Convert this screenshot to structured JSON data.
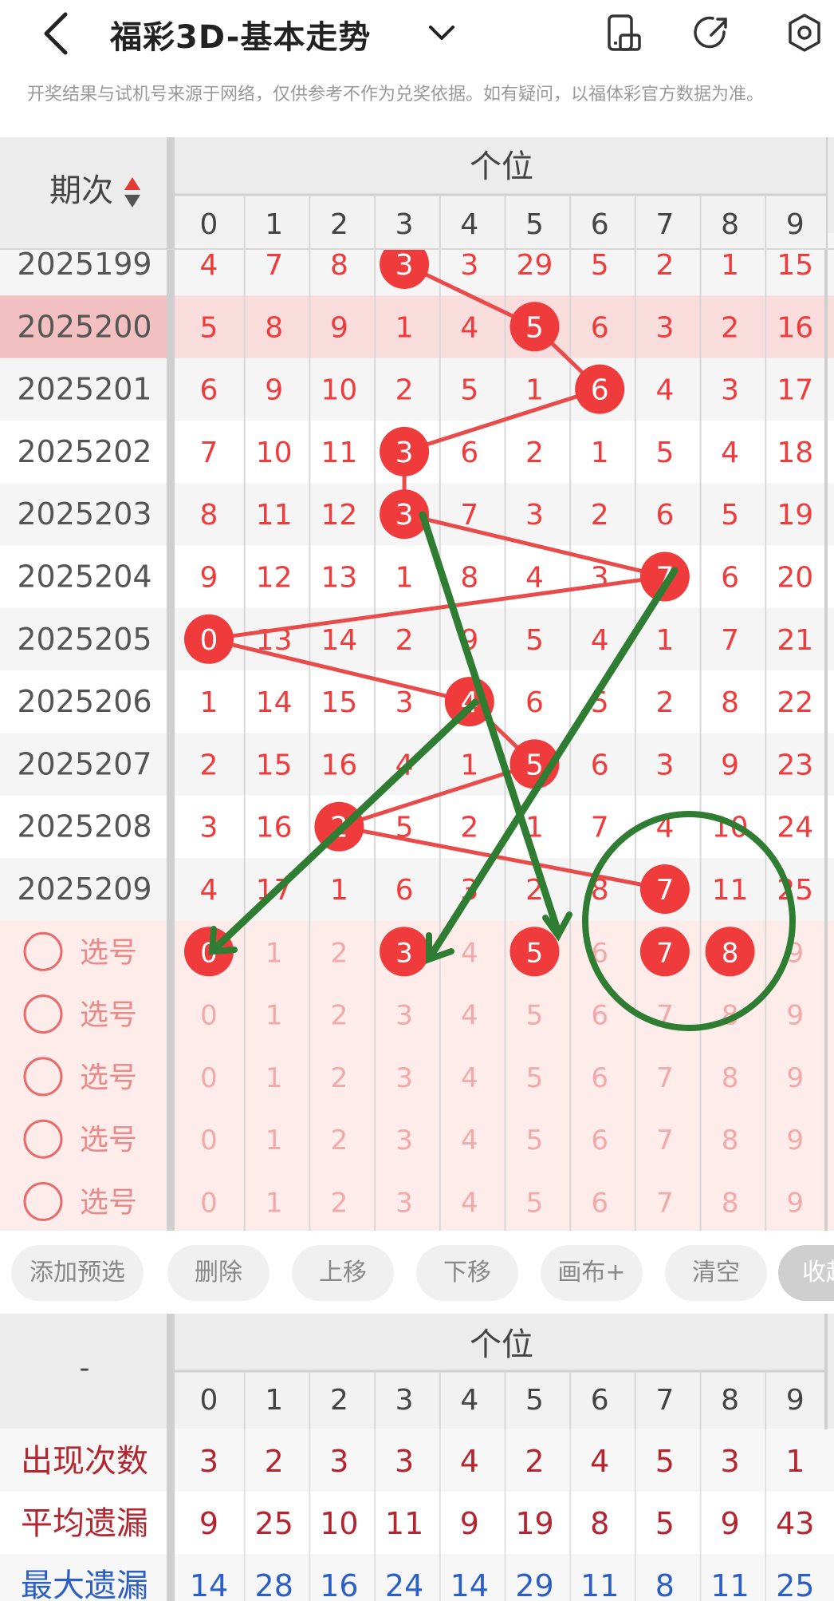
{
  "header": {
    "title": "福彩3D-基本走势",
    "icons": [
      "back-icon",
      "chevron-down-icon",
      "phone-rotate-icon",
      "share-icon",
      "settings-icon"
    ]
  },
  "notice": "开奖结果与试机号来源于网络，仅供参考不作为兑奖依据。如有疑问，以福体彩官方数据为准。",
  "table": {
    "period_header": "期次",
    "group_header": "个位",
    "digits": [
      "0",
      "1",
      "2",
      "3",
      "4",
      "5",
      "6",
      "7",
      "8",
      "9"
    ],
    "rows": [
      {
        "period": "2025199",
        "values": [
          "4",
          "7",
          "8",
          "3",
          "3",
          "29",
          "5",
          "2",
          "1",
          "15"
        ],
        "hit": 3
      },
      {
        "period": "2025200",
        "values": [
          "5",
          "8",
          "9",
          "1",
          "4",
          "5",
          "6",
          "3",
          "2",
          "16"
        ],
        "hit": 5,
        "highlight": true
      },
      {
        "period": "2025201",
        "values": [
          "6",
          "9",
          "10",
          "2",
          "5",
          "1",
          "6",
          "4",
          "3",
          "17"
        ],
        "hit": 6
      },
      {
        "period": "2025202",
        "values": [
          "7",
          "10",
          "11",
          "3",
          "6",
          "2",
          "1",
          "5",
          "4",
          "18"
        ],
        "hit": 3
      },
      {
        "period": "2025203",
        "values": [
          "8",
          "11",
          "12",
          "3",
          "7",
          "3",
          "2",
          "6",
          "5",
          "19"
        ],
        "hit": 3
      },
      {
        "period": "2025204",
        "values": [
          "9",
          "12",
          "13",
          "1",
          "8",
          "4",
          "3",
          "7",
          "6",
          "20"
        ],
        "hit": 7
      },
      {
        "period": "2025205",
        "values": [
          "0",
          "13",
          "14",
          "2",
          "9",
          "5",
          "4",
          "1",
          "7",
          "21"
        ],
        "hit": 0
      },
      {
        "period": "2025206",
        "values": [
          "1",
          "14",
          "15",
          "3",
          "4",
          "6",
          "5",
          "2",
          "8",
          "22"
        ],
        "hit": 4
      },
      {
        "period": "2025207",
        "values": [
          "2",
          "15",
          "16",
          "4",
          "1",
          "5",
          "6",
          "3",
          "9",
          "23"
        ],
        "hit": 5
      },
      {
        "period": "2025208",
        "values": [
          "3",
          "16",
          "2",
          "5",
          "2",
          "1",
          "7",
          "4",
          "10",
          "24"
        ],
        "hit": 2
      },
      {
        "period": "2025209",
        "values": [
          "4",
          "17",
          "1",
          "6",
          "3",
          "2",
          "8",
          "7",
          "11",
          "25"
        ],
        "hit": 7
      }
    ],
    "pick_rows": [
      {
        "label": "选号",
        "selected": [
          0,
          3,
          5,
          7,
          8
        ]
      },
      {
        "label": "选号",
        "selected": []
      },
      {
        "label": "选号",
        "selected": []
      },
      {
        "label": "选号",
        "selected": []
      },
      {
        "label": "选号",
        "selected": []
      }
    ]
  },
  "toolbar": {
    "buttons": [
      "添加预选",
      "删除",
      "上移",
      "下移",
      "画布+",
      "清空",
      "收起"
    ]
  },
  "stats": {
    "corner": "-",
    "group_header": "个位",
    "rows": [
      {
        "label": "出现次数",
        "values": [
          "3",
          "2",
          "3",
          "3",
          "4",
          "2",
          "4",
          "5",
          "3",
          "1"
        ],
        "color": "#b3262f"
      },
      {
        "label": "平均遗漏",
        "values": [
          "9",
          "25",
          "10",
          "11",
          "9",
          "19",
          "8",
          "5",
          "9",
          "43"
        ],
        "color": "#b3262f"
      },
      {
        "label": "最大遗漏",
        "values": [
          "14",
          "28",
          "16",
          "24",
          "14",
          "29",
          "11",
          "8",
          "11",
          "25"
        ],
        "color": "#2b5fc7"
      }
    ]
  },
  "colors": {
    "red": "#ef3b3b",
    "green": "#2e7d32",
    "pick_bg": "#fdece9",
    "header_bg": "#ececec"
  }
}
